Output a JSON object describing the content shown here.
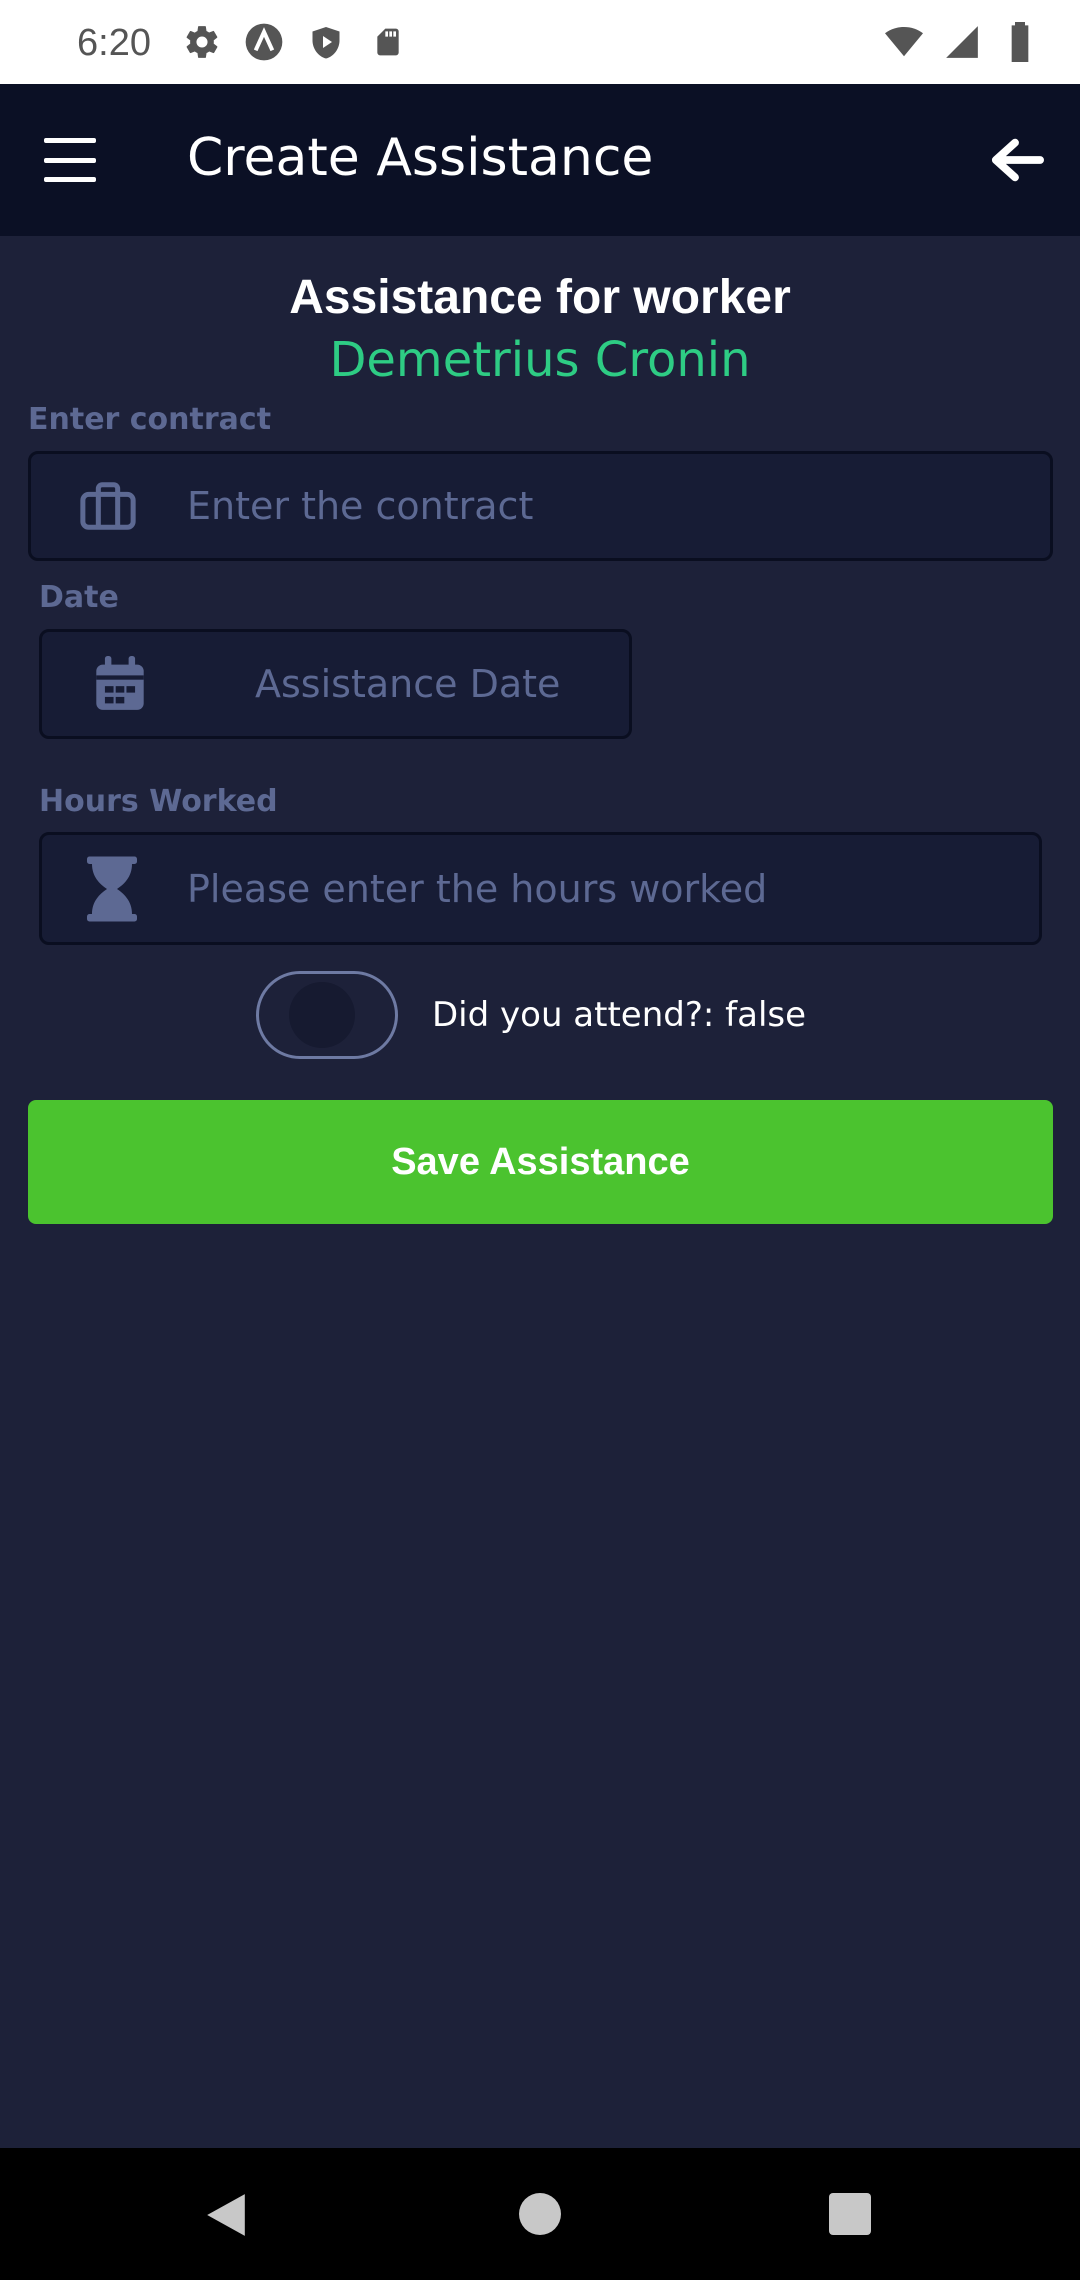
{
  "status_bar": {
    "time": "6:20",
    "left_icons": [
      "gear-icon",
      "android-auto-icon",
      "shield-play-icon",
      "sd-card-icon"
    ],
    "right_icons": [
      "wifi-icon",
      "signal-icon",
      "battery-icon"
    ]
  },
  "app_bar": {
    "title": "Create Assistance",
    "menu_icon": "hamburger-menu-icon",
    "back_icon": "arrow-left-icon"
  },
  "heading": {
    "title": "Assistance for worker",
    "worker_name": "Demetrius Cronin"
  },
  "contract": {
    "label": "Enter contract",
    "placeholder": "Enter the contract",
    "value": "",
    "icon": "briefcase-icon"
  },
  "date": {
    "label": "Date",
    "placeholder": "Assistance Date",
    "value": "",
    "icon": "calendar-icon"
  },
  "hours": {
    "label": "Hours Worked",
    "placeholder": "Please enter the hours worked",
    "value": "",
    "icon": "hourglass-icon"
  },
  "attendance": {
    "label": "Did you attend?: false",
    "checked": false
  },
  "save_button": {
    "label": "Save Assistance"
  },
  "colors": {
    "background": "#1d2139",
    "app_bar": "#0b1025",
    "accent_green": "#2ecc84",
    "button_green": "#4bc32f",
    "muted_label": "#5d6993"
  },
  "nav_bar": {
    "icons": [
      "nav-back-icon",
      "nav-home-icon",
      "nav-recents-icon"
    ]
  }
}
